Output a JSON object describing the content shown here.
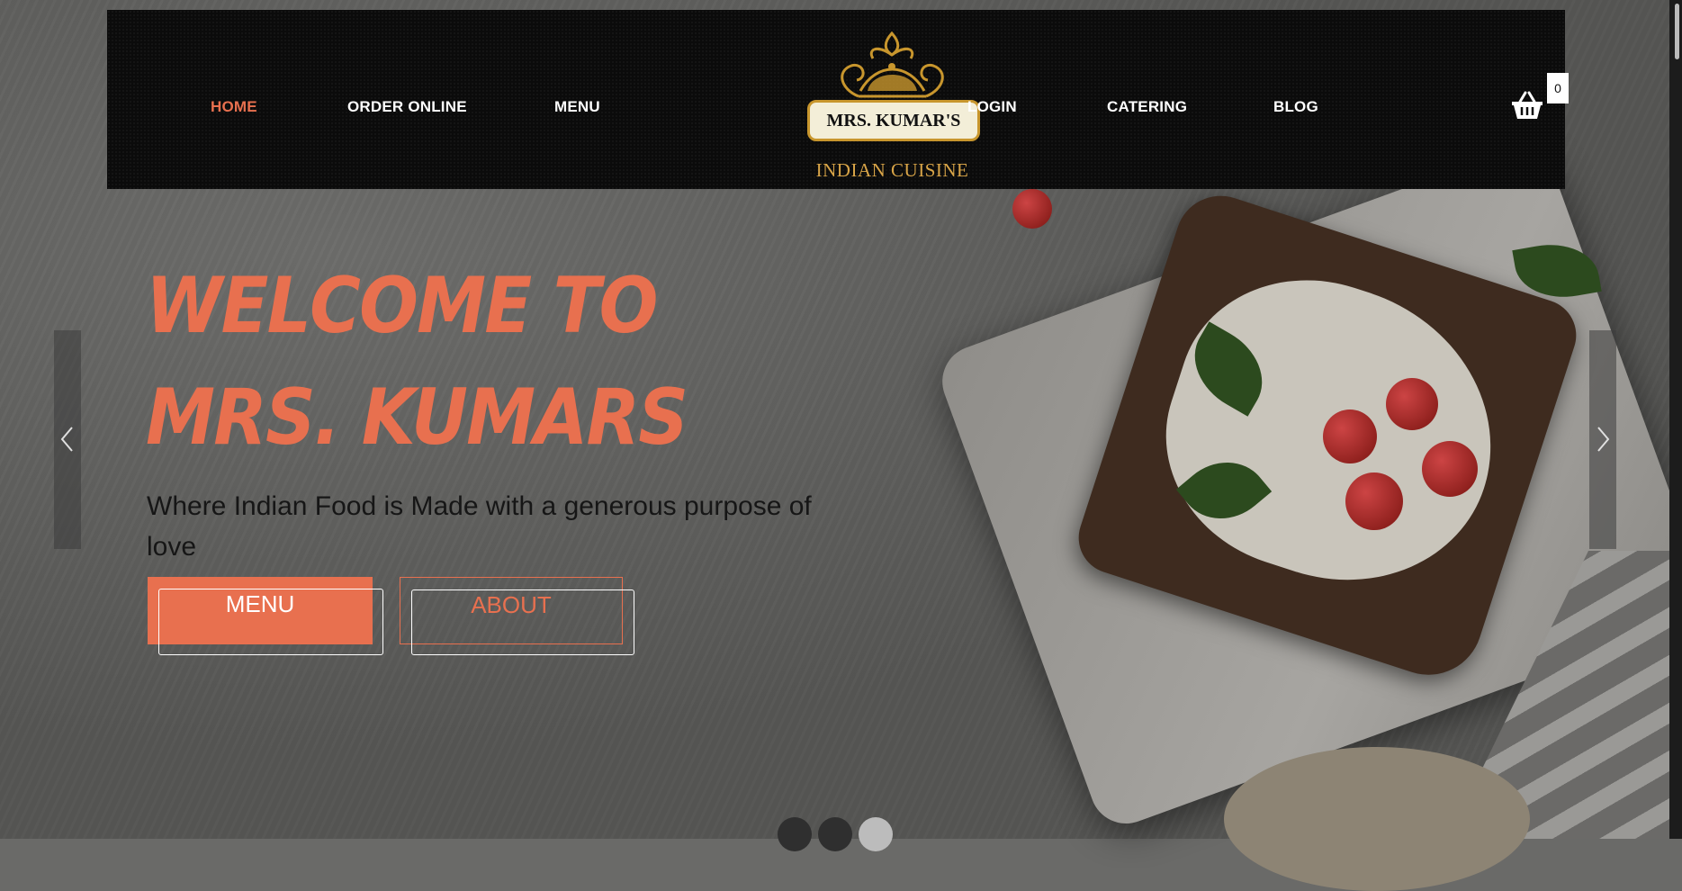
{
  "nav": {
    "home": "HOME",
    "order_online": "ORDER ONLINE",
    "menu": "MENU",
    "login": "LOGIN",
    "catering": "CATERING",
    "blog": "BLOG",
    "active_color": "#e8704f"
  },
  "logo": {
    "name": "MRS. KUMAR'S",
    "subtitle": "INDIAN CUISINE"
  },
  "cart": {
    "icon": "basket-icon",
    "count": "0"
  },
  "hero": {
    "title": "WELCOME TO MRS. KUMARS",
    "subtitle": "Where Indian Food is Made with a generous purpose of love",
    "menu_button": "MENU",
    "about_button": "ABOUT",
    "accent_color": "#e8704f"
  },
  "carousel": {
    "prev_icon": "chevron-left-icon",
    "next_icon": "chevron-right-icon",
    "slides_total": 3,
    "active_slide": 3
  }
}
